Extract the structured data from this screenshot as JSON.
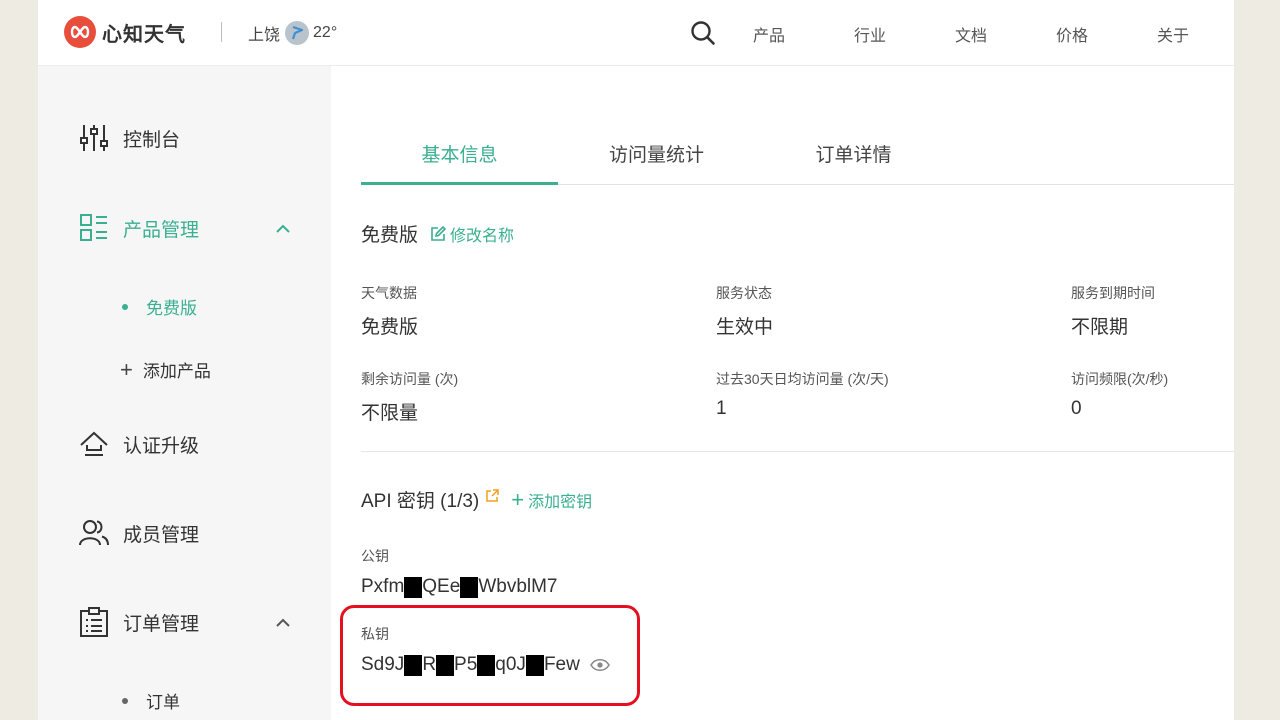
{
  "header": {
    "brand": "心知天气",
    "location": "上饶",
    "temperature": "22°",
    "nav": [
      "产品",
      "行业",
      "文档",
      "价格",
      "关于"
    ]
  },
  "sidebar": {
    "dashboard": "控制台",
    "product_mgmt": "产品管理",
    "free_plan": "免费版",
    "add_product": "添加产品",
    "upgrade": "认证升级",
    "members": "成员管理",
    "orders_mgmt": "订单管理",
    "orders": "订单"
  },
  "tabs": [
    "基本信息",
    "访问量统计",
    "订单详情"
  ],
  "plan": {
    "name": "免费版",
    "rename_label": "修改名称"
  },
  "info": {
    "weather_data": {
      "label": "天气数据",
      "value": "免费版"
    },
    "service_status": {
      "label": "服务状态",
      "value": "生效中"
    },
    "expire": {
      "label": "服务到期时间",
      "value": "不限期"
    },
    "remaining": {
      "label": "剩余访问量 (次)",
      "value": "不限量"
    },
    "avg30": {
      "label": "过去30天日均访问量 (次/天)",
      "value": "1"
    },
    "rate_limit": {
      "label": "访问频限(次/秒)",
      "value": "0"
    }
  },
  "api": {
    "title": "API 密钥 (1/3)",
    "add_label": "添加密钥",
    "public_label": "公钥",
    "public_parts": [
      "Pxfm",
      "QEe",
      "WbvblM7"
    ],
    "private_label": "私钥",
    "private_parts": [
      "Sd9J",
      "R",
      "P5",
      "q0J",
      "Few"
    ]
  },
  "colors": {
    "accent": "#3aaf91",
    "highlight": "#e5101f",
    "logo": "#e94e3c"
  },
  "icons": [
    "logo-icon",
    "weather-icon",
    "search-icon",
    "sliders-icon",
    "grid-list-icon",
    "chevron-up-icon",
    "upload-icon",
    "users-icon",
    "clipboard-icon",
    "edit-icon",
    "external-link-icon",
    "eye-icon"
  ]
}
